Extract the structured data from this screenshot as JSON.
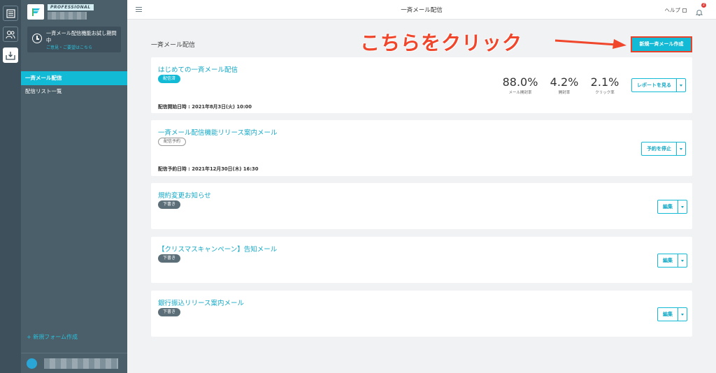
{
  "sidebar": {
    "brand_badge": "PROFESSIONAL",
    "trial_text": "一斉メール配信機能お試し期間中",
    "trial_link": "ご意見・ご要望はこちら",
    "nav": [
      {
        "label": "一斉メール配信",
        "active": true
      },
      {
        "label": "配信リスト一覧",
        "active": false
      }
    ],
    "new_form": "+ 新規フォーム作成"
  },
  "topbar": {
    "title": "一斉メール配信",
    "help": "ヘルプ",
    "notification_count": "2"
  },
  "main": {
    "title": "一斉メール配信",
    "annotation": "こちらをクリック",
    "create_button": "新規一斉メール作成",
    "campaigns": [
      {
        "title": "はじめての一斉メール配信",
        "status": "配信済",
        "meta": "配信開始日時 : 2021年8月3日(火) 10:00",
        "stats": [
          {
            "value": "88.0%",
            "label": "メール開封率"
          },
          {
            "value": "4.2%",
            "label": "開封率"
          },
          {
            "value": "2.1%",
            "label": "クリック率"
          }
        ],
        "action": "レポートを見る"
      },
      {
        "title": "一斉メール配信機能リリース案内メール",
        "status": "配信予約",
        "meta": "配信予約日時 : 2021年12月30日(木) 16:30",
        "action": "予約を停止"
      },
      {
        "title": "規約変更お知らせ",
        "status": "下書き",
        "action": "編集"
      },
      {
        "title": "【クリスマスキャンペーン】告知メール",
        "status": "下書き",
        "action": "編集"
      },
      {
        "title": "銀行振込リリース案内メール",
        "status": "下書き",
        "action": "編集"
      }
    ]
  },
  "colors": {
    "accent": "#13bad6",
    "sidebar": "#4a5f6a",
    "rail": "#3d505b",
    "annotation": "#f0462b"
  }
}
